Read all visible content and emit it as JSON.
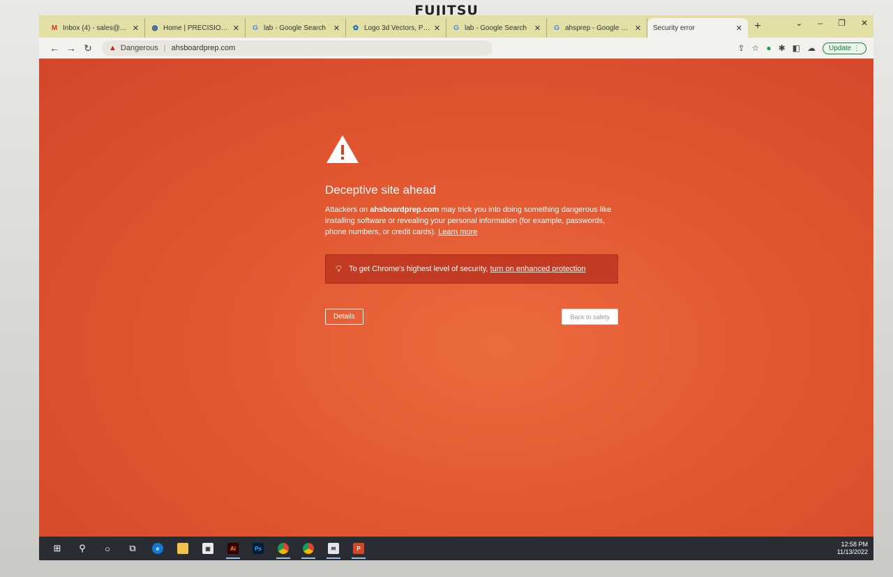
{
  "monitor": {
    "brand": "FUJITSU"
  },
  "browser": {
    "tabs": [
      {
        "label": "Inbox (4) - sales@bluskyir",
        "icon": "gmail-icon",
        "active": false
      },
      {
        "label": "Home | PRECISION ACCOU",
        "icon": "site-icon",
        "active": false
      },
      {
        "label": "lab - Google Search",
        "icon": "google-icon",
        "active": false
      },
      {
        "label": "Logo 3d Vectors, Photos a",
        "icon": "site-icon",
        "active": false
      },
      {
        "label": "lab - Google Search",
        "icon": "google-icon",
        "active": false
      },
      {
        "label": "ahsprep - Google Search",
        "icon": "google-icon",
        "active": false
      },
      {
        "label": "Security error",
        "icon": "none",
        "active": true
      }
    ],
    "omnibox": {
      "status": "Dangerous",
      "url": "ahsboardprep.com"
    },
    "update_label": "Update"
  },
  "interstitial": {
    "heading": "Deceptive site ahead",
    "body_prefix": "Attackers on ",
    "body_domain": "ahsboardprep.com",
    "body_suffix": " may trick you into doing something dangerous like installing software or revealing your personal information (for example, passwords, phone numbers, or credit cards). ",
    "learn_more": "Learn more",
    "enhanced_prefix": "To get Chrome's highest level of security, ",
    "enhanced_link": "turn on enhanced protection",
    "details_label": "Details",
    "back_label": "Back to safety"
  },
  "taskbar": {
    "time": "12:58 PM",
    "date": "11/13/2022"
  },
  "colors": {
    "interstitial_bg": "#e25730",
    "enhanced_bg": "#c23b22"
  }
}
